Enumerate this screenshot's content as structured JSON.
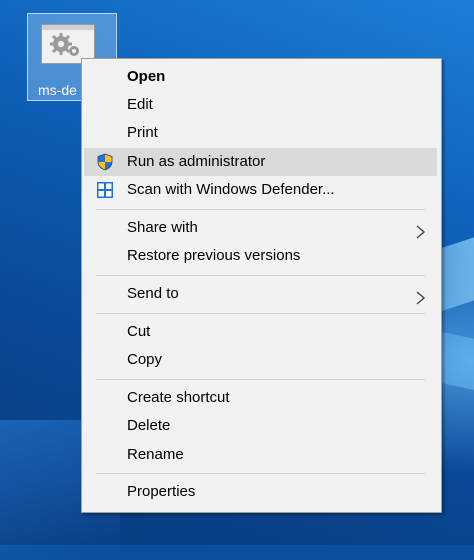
{
  "desktop": {
    "icon": {
      "label": "ms-de",
      "icon": "settings-gear-document-icon"
    }
  },
  "context_menu": {
    "items": [
      {
        "label": "Open",
        "bold": true
      },
      {
        "label": "Edit"
      },
      {
        "label": "Print"
      },
      {
        "label": "Run as administrator",
        "icon": "shield-uac-icon",
        "highlighted": true
      },
      {
        "label": "Scan with Windows Defender...",
        "icon": "windows-defender-icon"
      },
      {
        "label": "Share with",
        "submenu": true
      },
      {
        "label": "Restore previous versions"
      },
      {
        "label": "Send to",
        "submenu": true
      },
      {
        "label": "Cut"
      },
      {
        "label": "Copy"
      },
      {
        "label": "Create shortcut"
      },
      {
        "label": "Delete"
      },
      {
        "label": "Rename"
      },
      {
        "label": "Properties"
      }
    ]
  },
  "colors": {
    "menu_background": "#f2f2f2",
    "highlight": "#dadada",
    "separator": "#cfcfcf",
    "desktop_blue": "#0e5fb8"
  }
}
